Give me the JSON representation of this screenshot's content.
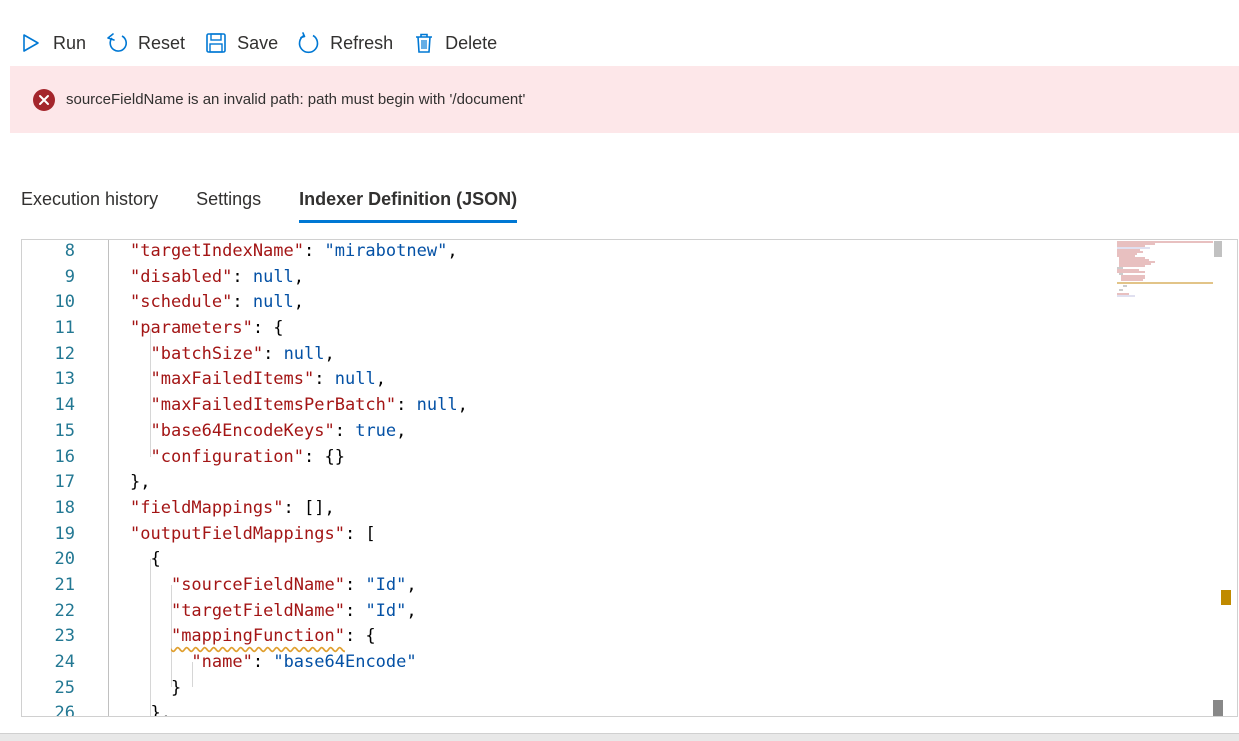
{
  "toolbar": {
    "run_label": "Run",
    "reset_label": "Reset",
    "save_label": "Save",
    "refresh_label": "Refresh",
    "delete_label": "Delete"
  },
  "error": {
    "message": "sourceFieldName is an invalid path: path must begin with '/document'"
  },
  "tabs": [
    {
      "label": "Execution history"
    },
    {
      "label": "Settings"
    },
    {
      "label": "Indexer Definition (JSON)"
    }
  ],
  "editor": {
    "lines": [
      {
        "num": "8"
      },
      {
        "num": "9"
      },
      {
        "num": "10"
      },
      {
        "num": "11"
      },
      {
        "num": "12"
      },
      {
        "num": "13"
      },
      {
        "num": "14"
      },
      {
        "num": "15"
      },
      {
        "num": "16"
      },
      {
        "num": "17"
      },
      {
        "num": "18"
      },
      {
        "num": "19"
      },
      {
        "num": "20"
      },
      {
        "num": "21"
      },
      {
        "num": "22"
      },
      {
        "num": "23"
      },
      {
        "num": "24"
      },
      {
        "num": "25"
      },
      {
        "num": "26"
      }
    ],
    "tokens": {
      "l8_key": "\"targetIndexName\"",
      "l8_val": "\"mirabotnew\"",
      "l9_key": "\"disabled\"",
      "l9_val": "null",
      "l10_key": "\"schedule\"",
      "l10_val": "null",
      "l11_key": "\"parameters\"",
      "l12_key": "\"batchSize\"",
      "l12_val": "null",
      "l13_key": "\"maxFailedItems\"",
      "l13_val": "null",
      "l14_key": "\"maxFailedItemsPerBatch\"",
      "l14_val": "null",
      "l15_key": "\"base64EncodeKeys\"",
      "l15_val": "true",
      "l16_key": "\"configuration\"",
      "l18_key": "\"fieldMappings\"",
      "l19_key": "\"outputFieldMappings\"",
      "l21_key": "\"sourceFieldName\"",
      "l21_val": "\"Id\"",
      "l22_key": "\"targetFieldName\"",
      "l22_val": "\"Id\"",
      "l23_key": "\"mappingFunction\"",
      "l24_key": "\"name\"",
      "l24_val": "\"base64Encode\""
    }
  },
  "colors": {
    "accent": "#0078d4",
    "error_bg": "#fde7e9",
    "error_icon": "#a4262c",
    "json_key": "#a31515",
    "json_value": "#0451a5",
    "line_number": "#237893"
  },
  "icons": [
    "play-icon",
    "reset-icon",
    "save-icon",
    "refresh-icon",
    "delete-icon",
    "error-icon"
  ]
}
